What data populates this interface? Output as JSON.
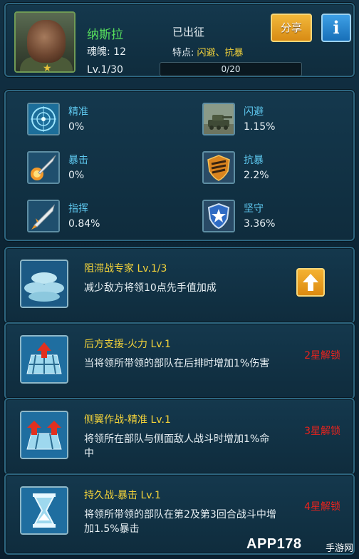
{
  "header": {
    "name": "纳斯拉",
    "soul": "魂魄: 12",
    "level": "Lv.1/30",
    "status": "已出征",
    "traits_label": "特点: ",
    "traits_value": "闪避、抗暴",
    "progress_text": "0/20",
    "progress_fraction": 0,
    "share_label": "分享",
    "info_label": "i"
  },
  "stats": [
    {
      "label": "精准",
      "value": "0%",
      "icon": "radar-icon"
    },
    {
      "label": "闪避",
      "value": "1.15%",
      "icon": "tank-icon"
    },
    {
      "label": "暴击",
      "value": "0%",
      "icon": "missile-icon"
    },
    {
      "label": "抗暴",
      "value": "2.2%",
      "icon": "shield-crest-icon"
    },
    {
      "label": "指挥",
      "value": "0.84%",
      "icon": "rocket-icon"
    },
    {
      "label": "坚守",
      "value": "3.36%",
      "icon": "star-shield-icon"
    }
  ],
  "skills": [
    {
      "name": "阻滞战专家 Lv.1/3",
      "desc": "减少敌方将领10点先手值加成",
      "lock": "",
      "icon": "sandbag-icon"
    },
    {
      "name": "后方支援-火力 Lv.1",
      "desc": "当将领所带领的部队在后排时增加1%伤害",
      "lock": "2星解锁",
      "icon": "rear-support-icon"
    },
    {
      "name": "侧翼作战-精准 Lv.1",
      "desc": "将领所在部队与侧面敌人战斗时增加1%命中",
      "lock": "3星解锁",
      "icon": "flank-icon"
    },
    {
      "name": "持久战-暴击 Lv.1",
      "desc": "将领所带领的部队在第2及第3回合战斗中增加1.5%暴击",
      "lock": "4星解锁",
      "icon": "hourglass-icon"
    }
  ],
  "watermark": {
    "text": "APP178",
    "sub": "手游网"
  },
  "colors": {
    "accent_green": "#57e05c",
    "accent_yellow": "#f2d23a",
    "lock_red": "#e8231d",
    "stat_label": "#5ec8ef"
  }
}
